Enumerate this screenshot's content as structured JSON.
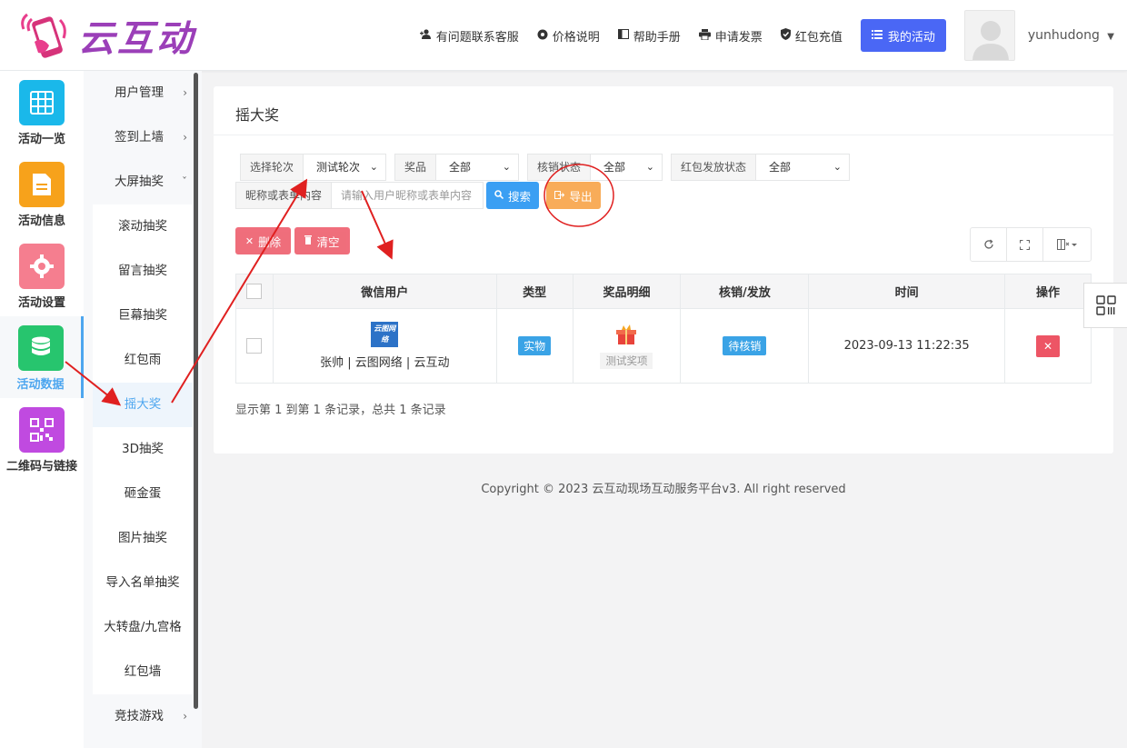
{
  "header": {
    "logo_text": "云互动",
    "nav": [
      {
        "label": "有问题联系客服",
        "icon": "user-plus-icon"
      },
      {
        "label": "价格说明",
        "icon": "gear-icon"
      },
      {
        "label": "帮助手册",
        "icon": "book-icon"
      },
      {
        "label": "申请发票",
        "icon": "printer-icon"
      },
      {
        "label": "红包充值",
        "icon": "shield-check-icon"
      }
    ],
    "my_activity": "我的活动",
    "username": "yunhudong"
  },
  "icon_sidebar": {
    "items": [
      {
        "label": "活动一览",
        "color": "#1ab8ea"
      },
      {
        "label": "活动信息",
        "color": "#f7a21b"
      },
      {
        "label": "活动设置",
        "color": "#f57e8f"
      },
      {
        "label": "活动数据",
        "color": "#27c56e"
      },
      {
        "label": "二维码与链接",
        "color": "#c04ae0"
      }
    ]
  },
  "sub_sidebar": {
    "items": [
      {
        "label": "用户管理"
      },
      {
        "label": "签到上墙"
      },
      {
        "label": "大屏抽奖"
      },
      {
        "label": "滚动抽奖"
      },
      {
        "label": "留言抽奖"
      },
      {
        "label": "巨幕抽奖"
      },
      {
        "label": "红包雨"
      },
      {
        "label": "摇大奖"
      },
      {
        "label": "3D抽奖"
      },
      {
        "label": "砸金蛋"
      },
      {
        "label": "图片抽奖"
      },
      {
        "label": "导入名单抽奖"
      },
      {
        "label": "大转盘/九宫格"
      },
      {
        "label": "红包墙"
      },
      {
        "label": "竞技游戏"
      }
    ]
  },
  "main": {
    "title": "摇大奖",
    "filters": {
      "round_label": "选择轮次",
      "round_value": "测试轮次",
      "prize_label": "奖品",
      "prize_value": "全部",
      "verify_label": "核销状态",
      "verify_value": "全部",
      "redpack_label": "红包发放状态",
      "redpack_value": "全部",
      "keyword_label": "昵称或表单内容",
      "keyword_placeholder": "请输入用户昵称或表单内容"
    },
    "buttons": {
      "search": "搜索",
      "export": "导出",
      "delete": "删除",
      "clear": "清空"
    },
    "table": {
      "headers": [
        "微信用户",
        "类型",
        "奖品明细",
        "核销/发放",
        "时间",
        "操作"
      ],
      "rows": [
        {
          "user_logo": "云图网络",
          "user": "张帅 | 云图网络 | 云互动",
          "type": "实物",
          "prize": "测试奖项",
          "status": "待核销",
          "time": "2023-09-13 11:22:35"
        }
      ]
    },
    "records": "显示第 1 到第 1 条记录，总共 1 条记录"
  },
  "footer": {
    "copyright": "Copyright © 2023 云互动现场互动服务平台v3. All right reserved"
  },
  "colors": {
    "primary": "#4a67f5",
    "info": "#3b9ff3",
    "warning": "#f8ac59",
    "danger": "#ed5565",
    "annotation": "#e02020"
  }
}
